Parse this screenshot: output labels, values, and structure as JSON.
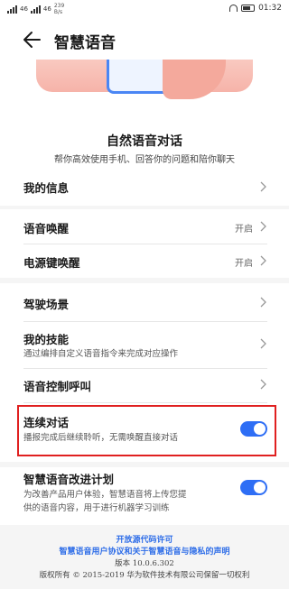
{
  "status_bar": {
    "signal_1": "46",
    "signal_2": "46",
    "speed_value": "239",
    "speed_unit": "B/s",
    "time": "01:32"
  },
  "header": {
    "title": "智慧语音",
    "back_icon": "arrow-left-icon"
  },
  "intro": {
    "title": "自然语音对话",
    "subtitle": "帮你高效使用手机、回答你的问题和陪你聊天"
  },
  "settings": {
    "my_info": {
      "label": "我的信息"
    },
    "voice_wakeup": {
      "label": "语音唤醒",
      "value": "开启"
    },
    "power_key_wakeup": {
      "label": "电源键唤醒",
      "value": "开启"
    },
    "driving_scene": {
      "label": "驾驶场景"
    },
    "my_skills": {
      "label": "我的技能",
      "description": "通过编排自定义语音指令来完成对应操作"
    },
    "voice_call": {
      "label": "语音控制呼叫"
    },
    "continuous_dialog": {
      "label": "连续对话",
      "description": "播报完成后继续聆听，无需唤醒直接对话",
      "enabled": true
    },
    "improvement_plan": {
      "label": "智慧语音改进计划",
      "description_line1": "为改善产品用户体验，智慧语音将上传您提",
      "description_line2": "供的语音内容，用于进行机器学习训练",
      "enabled": true
    }
  },
  "footer": {
    "open_source": "开放源代码许可",
    "agreement": "智慧语音用户协议和关于智慧语音与隐私的声明",
    "version": "版本  10.0.6.302",
    "copyright": "版权所有 © 2015-2019 华为软件技术有限公司保留一切权利"
  },
  "colors": {
    "accent": "#2e6ef5",
    "highlight_border": "#e02020",
    "link": "#2f6ee8"
  }
}
